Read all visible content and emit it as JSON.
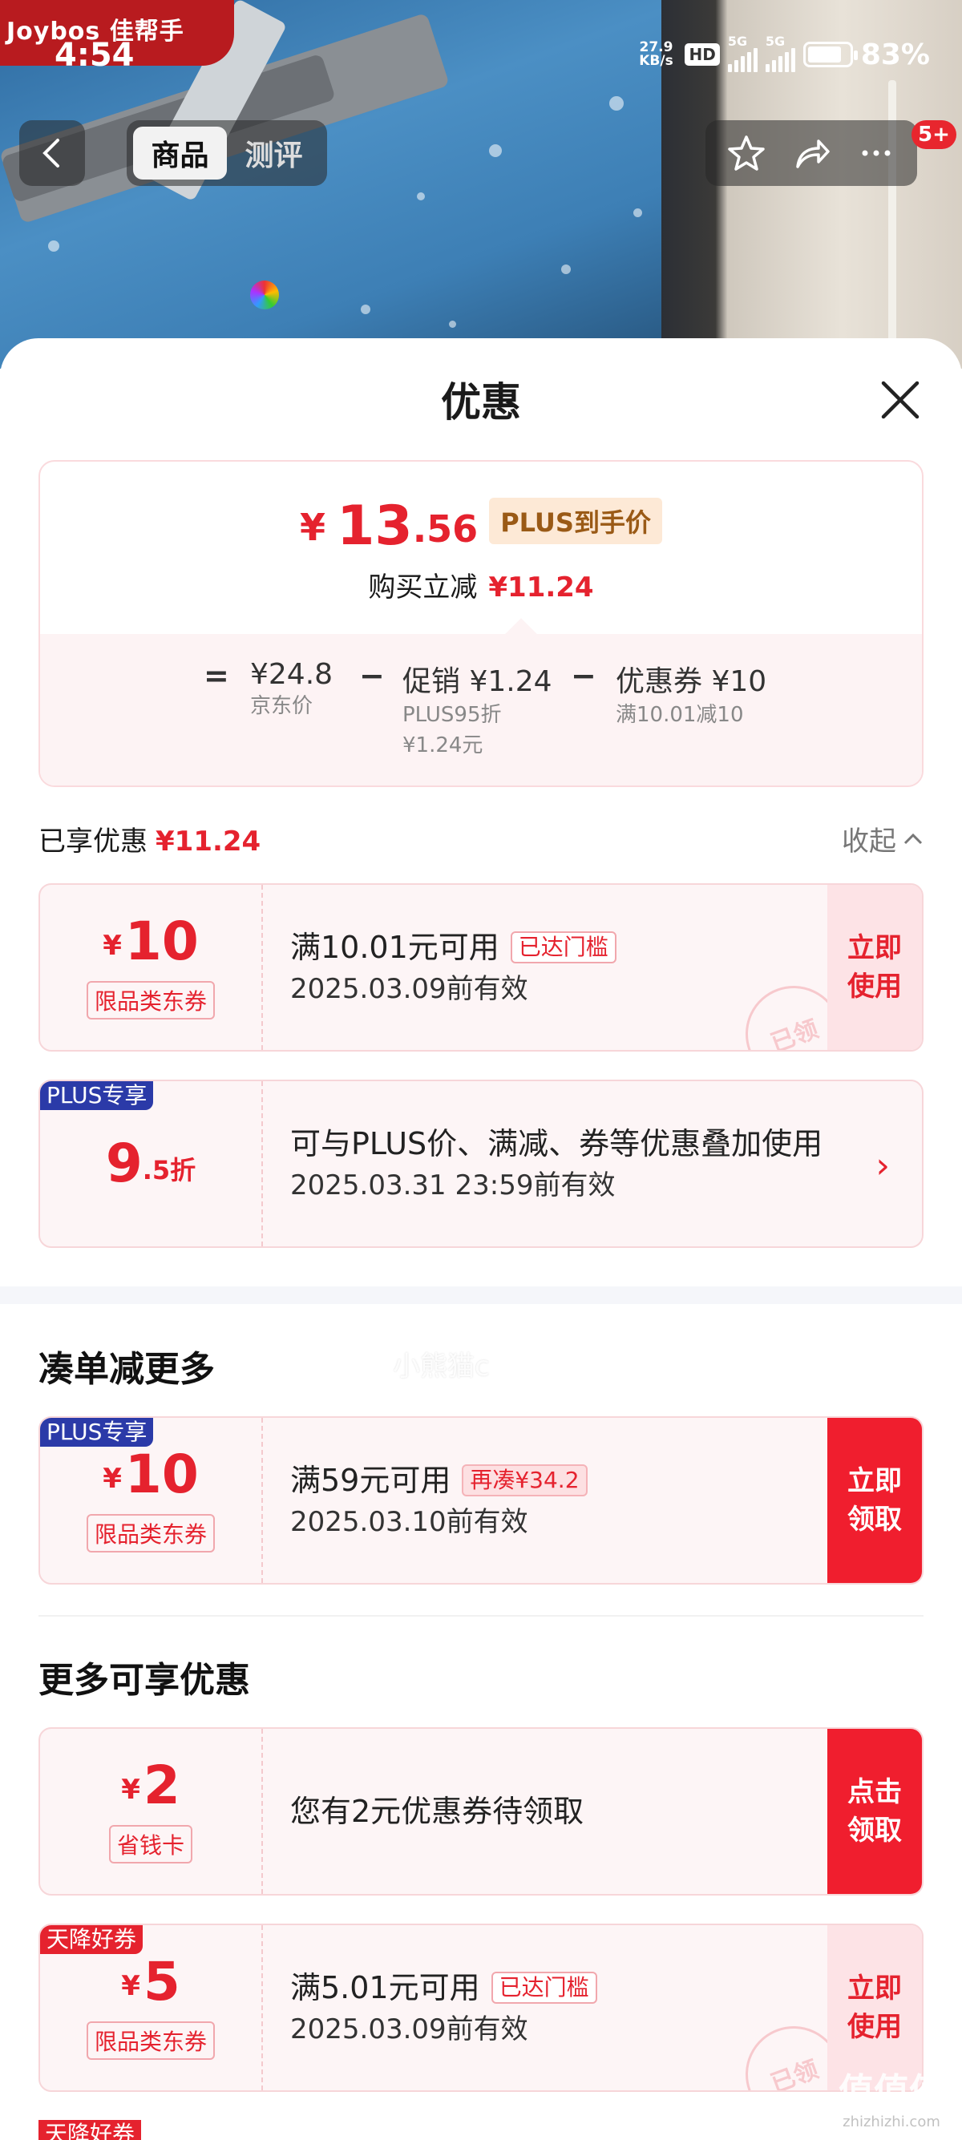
{
  "brand": {
    "logo_text": "Joybos 佳帮手"
  },
  "status_bar": {
    "time": "4:54",
    "net_speed": "27.9 KB/s",
    "hd": "HD",
    "sig1": "5G",
    "sig2": "5G",
    "battery": "83%"
  },
  "nav": {
    "tabs": [
      "商品",
      "测评"
    ],
    "active_tab": 0,
    "message_badge": "5+"
  },
  "sheet": {
    "title": "优惠",
    "summary": {
      "currency": "¥",
      "price_int": "13",
      "price_dec": ".56",
      "plus_tag": "PLUS到手价",
      "reduce_label": "购买立减",
      "reduce_value": "¥11.24",
      "eq": "=",
      "minus": "−",
      "base_price": "¥24.8",
      "base_label": "京东价",
      "promo": "促销 ¥1.24",
      "promo_sub1": "PLUS95折",
      "promo_sub2": "¥1.24元",
      "coupon": "优惠券 ¥10",
      "coupon_sub": "满10.01减10"
    },
    "enjoyed": {
      "label": "已享优惠",
      "value": "¥11.24",
      "collapse": "收起"
    },
    "coupons_enjoyed": [
      {
        "currency": "¥",
        "amount": "10",
        "category": "限品类东券",
        "cond": "满10.01元可用",
        "tag": "已达门槛",
        "valid": "2025.03.09前有效",
        "action": "立即\n使用",
        "stamp": "已领"
      },
      {
        "corner": "PLUS专享",
        "amount": "9",
        "suffix": ".5折",
        "cond": "可与PLUS价、满减、券等优惠叠加使用",
        "valid": "2025.03.31 23:59前有效"
      }
    ],
    "watermark": "小熊猫c",
    "more_section": {
      "title": "凑单减更多"
    },
    "coupon_more": {
      "corner": "PLUS专享",
      "currency": "¥",
      "amount": "10",
      "category": "限品类东券",
      "cond": "满59元可用",
      "tag": "再凑¥34.2",
      "valid": "2025.03.10前有效",
      "action": "立即\n领取"
    },
    "extra_section": {
      "title": "更多可享优惠"
    },
    "coupon_card": {
      "currency": "¥",
      "amount": "2",
      "category": "省钱卡",
      "cond": "您有2元优惠券待领取",
      "action": "点击\n领取"
    },
    "coupon_sky": {
      "corner": "天降好券",
      "currency": "¥",
      "amount": "5",
      "category": "限品类东券",
      "cond": "满5.01元可用",
      "tag": "已达门槛",
      "valid": "2025.03.09前有效",
      "action": "立即\n使用",
      "stamp": "已领"
    },
    "coupon_sky2": {
      "corner": "天降好券"
    }
  },
  "site_mark": {
    "text": "值值值",
    "sub": "zhizhizhi.com"
  },
  "colors": {
    "accent": "#e5222e",
    "plus_blue": "#2b3aa8"
  }
}
